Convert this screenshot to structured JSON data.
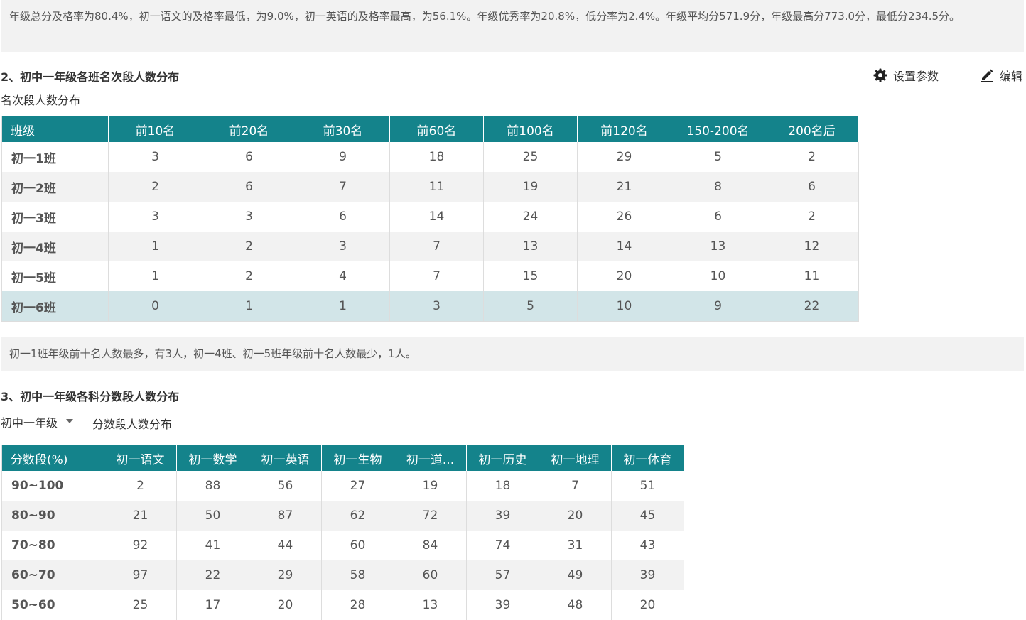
{
  "summary1": "年级总分及格率为80.4%，初一语文的及格率最低，为9.0%，初一英语的及格率最高，为56.1%。年级优秀率为20.8%，低分率为2.4%。年级平均分571.9分，年级最高分773.0分，最低分234.5分。",
  "section2": {
    "title": "2、初中一年级各班名次段人数分布",
    "subtitle": "名次段人数分布",
    "settings_label": "设置参数",
    "edit_label": "编辑",
    "headers": [
      "班级",
      "前10名",
      "前20名",
      "前30名",
      "前60名",
      "前100名",
      "前120名",
      "150-200名",
      "200名后"
    ],
    "rows": [
      [
        "初一1班",
        "3",
        "6",
        "9",
        "18",
        "25",
        "29",
        "5",
        "2"
      ],
      [
        "初一2班",
        "2",
        "6",
        "7",
        "11",
        "19",
        "21",
        "8",
        "6"
      ],
      [
        "初一3班",
        "3",
        "3",
        "6",
        "14",
        "24",
        "26",
        "6",
        "2"
      ],
      [
        "初一4班",
        "1",
        "2",
        "3",
        "7",
        "13",
        "14",
        "13",
        "12"
      ],
      [
        "初一5班",
        "1",
        "2",
        "4",
        "7",
        "15",
        "20",
        "10",
        "11"
      ],
      [
        "初一6班",
        "0",
        "1",
        "1",
        "3",
        "5",
        "10",
        "9",
        "22"
      ]
    ]
  },
  "summary2": "初一1班年级前十名人数最多，有3人，初一4班、初一5班年级前十名人数最少，1人。",
  "section3": {
    "title": "3、初中一年级各科分数段人数分布",
    "grade_select": "初中一年级",
    "subtitle": "分数段人数分布",
    "headers": [
      "分数段(%)",
      "初一语文",
      "初一数学",
      "初一英语",
      "初一生物",
      "初一道...",
      "初一历史",
      "初一地理",
      "初一体育"
    ],
    "rows": [
      [
        "90~100",
        "2",
        "88",
        "56",
        "27",
        "19",
        "18",
        "7",
        "51"
      ],
      [
        "80~90",
        "21",
        "50",
        "87",
        "62",
        "72",
        "39",
        "20",
        "45"
      ],
      [
        "70~80",
        "92",
        "41",
        "44",
        "60",
        "84",
        "74",
        "31",
        "43"
      ],
      [
        "60~70",
        "97",
        "22",
        "29",
        "58",
        "60",
        "57",
        "49",
        "39"
      ],
      [
        "50~60",
        "25",
        "17",
        "20",
        "28",
        "13",
        "39",
        "48",
        "20"
      ]
    ]
  },
  "colors": {
    "header_bg": "#14838b",
    "highlight_row": "#d2e5e8",
    "stripe": "#f2f2f2"
  },
  "icons": {
    "settings": "gear-icon",
    "edit": "pencil-icon",
    "dropdown": "caret-down-icon"
  }
}
